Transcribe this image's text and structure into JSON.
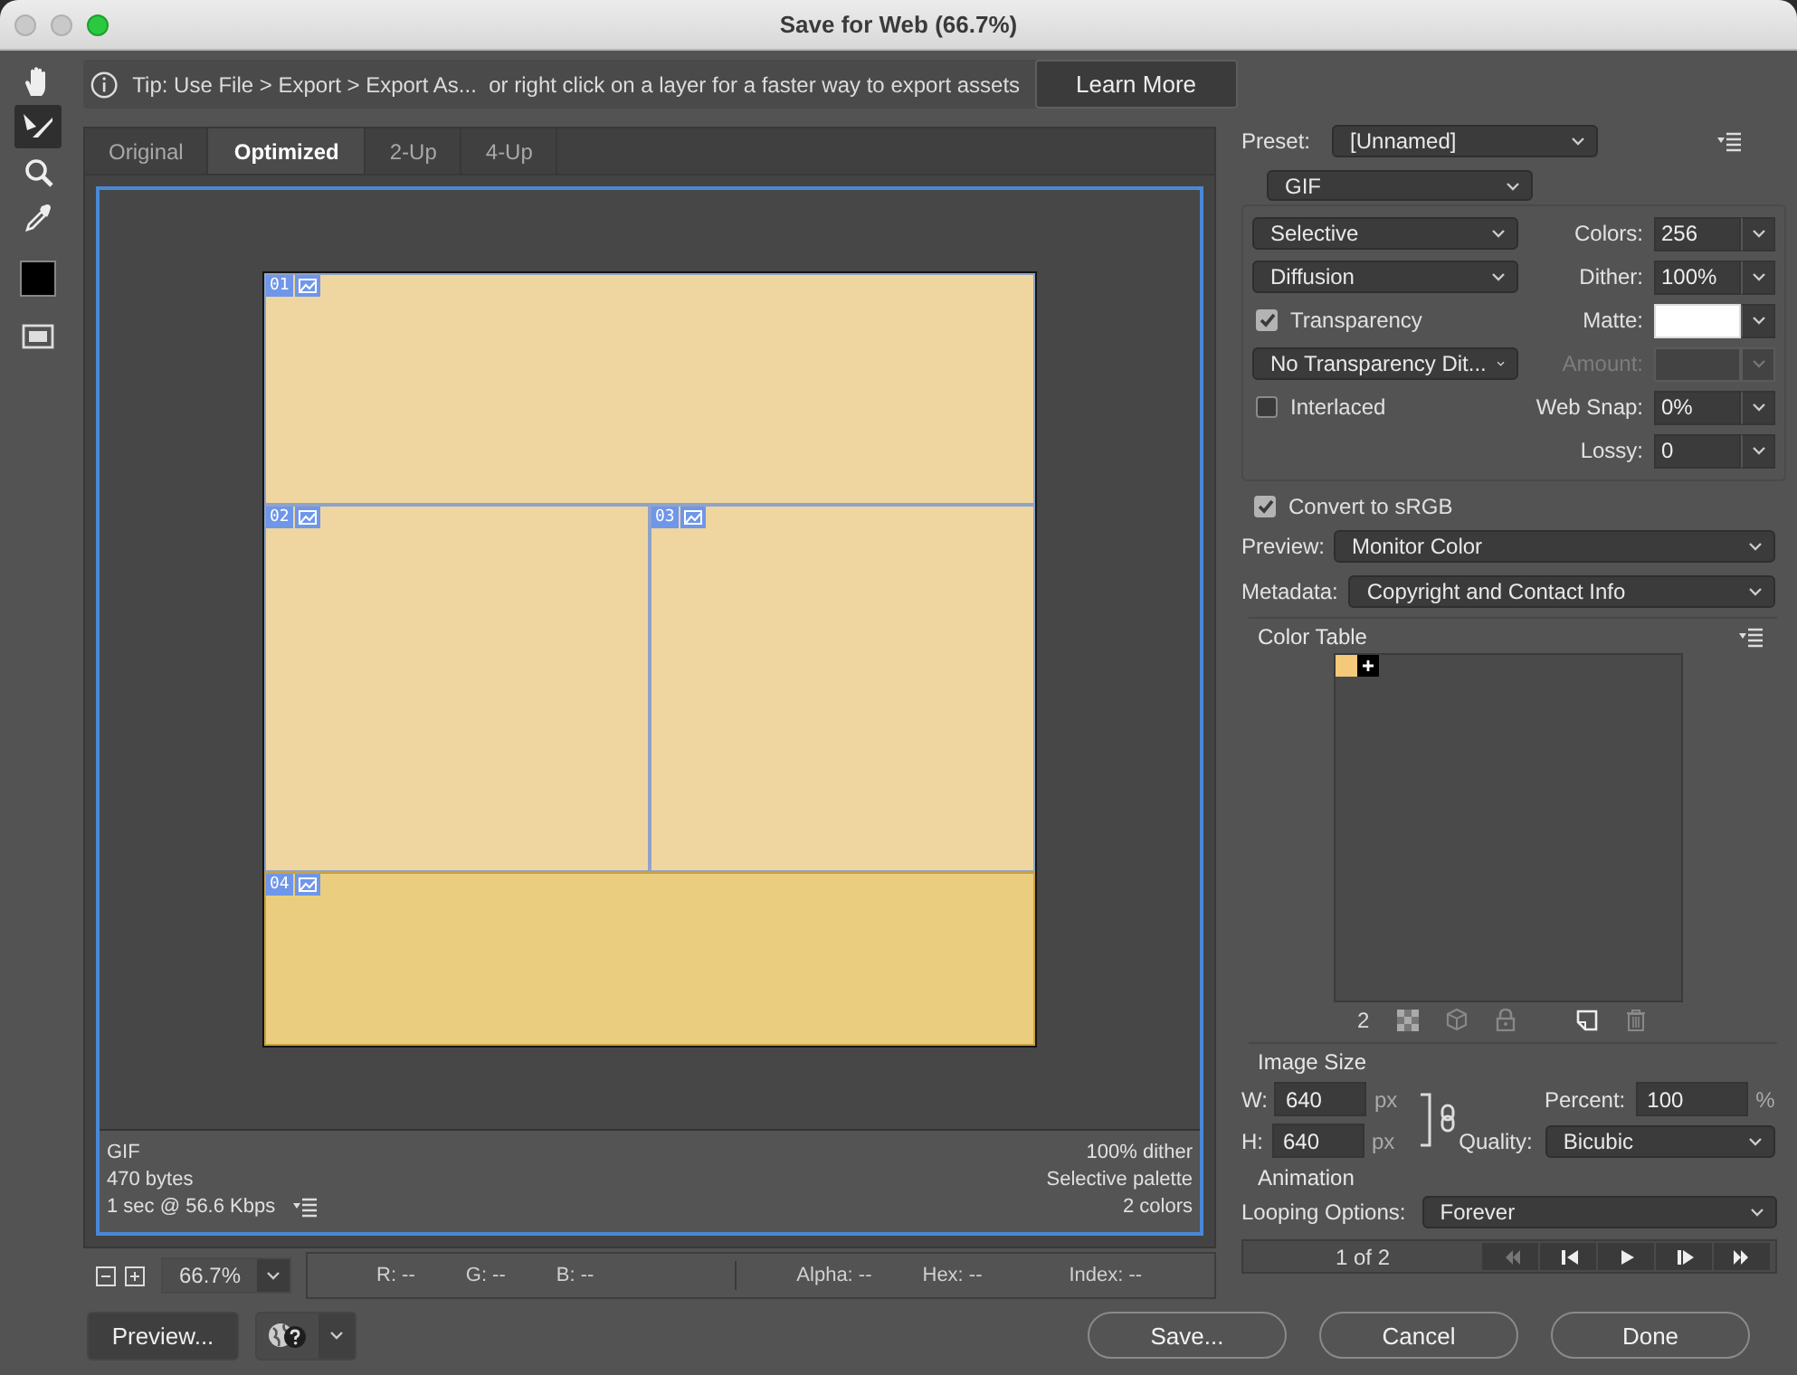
{
  "window": {
    "title": "Save for Web (66.7%)"
  },
  "tools": [
    {
      "kind": "hand",
      "selected": false
    },
    {
      "kind": "slice-select",
      "selected": true
    },
    {
      "kind": "zoom",
      "selected": false
    },
    {
      "kind": "eyedropper",
      "selected": false
    },
    {
      "kind": "swatch",
      "selected": false
    },
    {
      "kind": "slice-visibility",
      "selected": false
    }
  ],
  "tip": {
    "text": "Tip: Use File > Export > Export As...  or right click on a layer for a faster way to export assets",
    "button": "Learn More"
  },
  "tabs": [
    {
      "label": "Original",
      "selected": false
    },
    {
      "label": "Optimized",
      "selected": true
    },
    {
      "label": "2-Up",
      "selected": false
    },
    {
      "label": "4-Up",
      "selected": false
    }
  ],
  "slice_rows": [
    {
      "slices": [
        {
          "number": "01",
          "selected": false
        }
      ]
    },
    {
      "slices": [
        {
          "number": "02",
          "selected": false
        },
        {
          "number": "03",
          "selected": false
        }
      ]
    },
    {
      "slices": [
        {
          "number": "04",
          "selected": true
        }
      ]
    }
  ],
  "info": {
    "left": [
      "GIF",
      "470 bytes",
      "1 sec @ 56.6 Kbps"
    ],
    "right": [
      "100% dither",
      "Selective palette",
      "2 colors"
    ]
  },
  "zoom": {
    "value": "66.7%"
  },
  "readouts": [
    "R: --",
    "G: --",
    "B: --",
    "Alpha: --",
    "Hex: --",
    "Index: --"
  ],
  "buttons": {
    "preview": "Preview...",
    "save": "Save...",
    "cancel": "Cancel",
    "done": "Done"
  },
  "settings": {
    "preset": {
      "label": "Preset:",
      "value": "[Unnamed]"
    },
    "format": "GIF",
    "rows": [
      {
        "left": {
          "kind": "dropdown",
          "value": "Selective"
        },
        "right": {
          "kind": "field",
          "label": "Colors:",
          "value": "256",
          "disabled": false
        }
      },
      {
        "left": {
          "kind": "dropdown",
          "value": "Diffusion"
        },
        "right": {
          "kind": "field",
          "label": "Dither:",
          "value": "100%",
          "disabled": false
        }
      },
      {
        "left": {
          "kind": "checkbox",
          "label": "Transparency",
          "checked": true
        },
        "right": {
          "kind": "swatch",
          "label": "Matte:",
          "disabled": false
        }
      },
      {
        "left": {
          "kind": "dropdown",
          "value": "No Transparency Dit..."
        },
        "right": {
          "kind": "field",
          "label": "Amount:",
          "disabled": true
        }
      },
      {
        "left": {
          "kind": "checkbox",
          "label": "Interlaced",
          "checked": false
        },
        "right": {
          "kind": "field",
          "label": "Web Snap:",
          "value": "0%",
          "disabled": false
        }
      },
      {
        "right": {
          "kind": "field",
          "label": "Lossy:",
          "value": "0",
          "disabled": false
        }
      }
    ],
    "convert_srgb": {
      "label": "Convert to sRGB",
      "checked": true
    },
    "preview": {
      "label": "Preview:",
      "value": "Monitor Color"
    },
    "metadata": {
      "label": "Metadata:",
      "value": "Copyright and Contact Info"
    }
  },
  "color_table": {
    "title": "Color Table",
    "swatches": [
      {
        "color": "#f5c97a",
        "kind": "color"
      },
      {
        "color": "#000000",
        "kind": "plus"
      }
    ],
    "count": "2"
  },
  "image_size": {
    "title": "Image Size",
    "width": {
      "label": "W:",
      "value": "640",
      "unit": "px"
    },
    "height": {
      "label": "H:",
      "value": "640",
      "unit": "px"
    },
    "percent": {
      "label": "Percent:",
      "value": "100",
      "unit": "%"
    },
    "quality": {
      "label": "Quality:",
      "value": "Bicubic"
    }
  },
  "animation": {
    "title": "Animation",
    "looping": {
      "label": "Looping Options:",
      "value": "Forever"
    },
    "frame": "1 of 2",
    "controls": [
      {
        "kind": "first",
        "disabled": true
      },
      {
        "kind": "previous",
        "disabled": false
      },
      {
        "kind": "play",
        "disabled": false
      },
      {
        "kind": "next",
        "disabled": false
      },
      {
        "kind": "last",
        "disabled": false
      }
    ]
  }
}
